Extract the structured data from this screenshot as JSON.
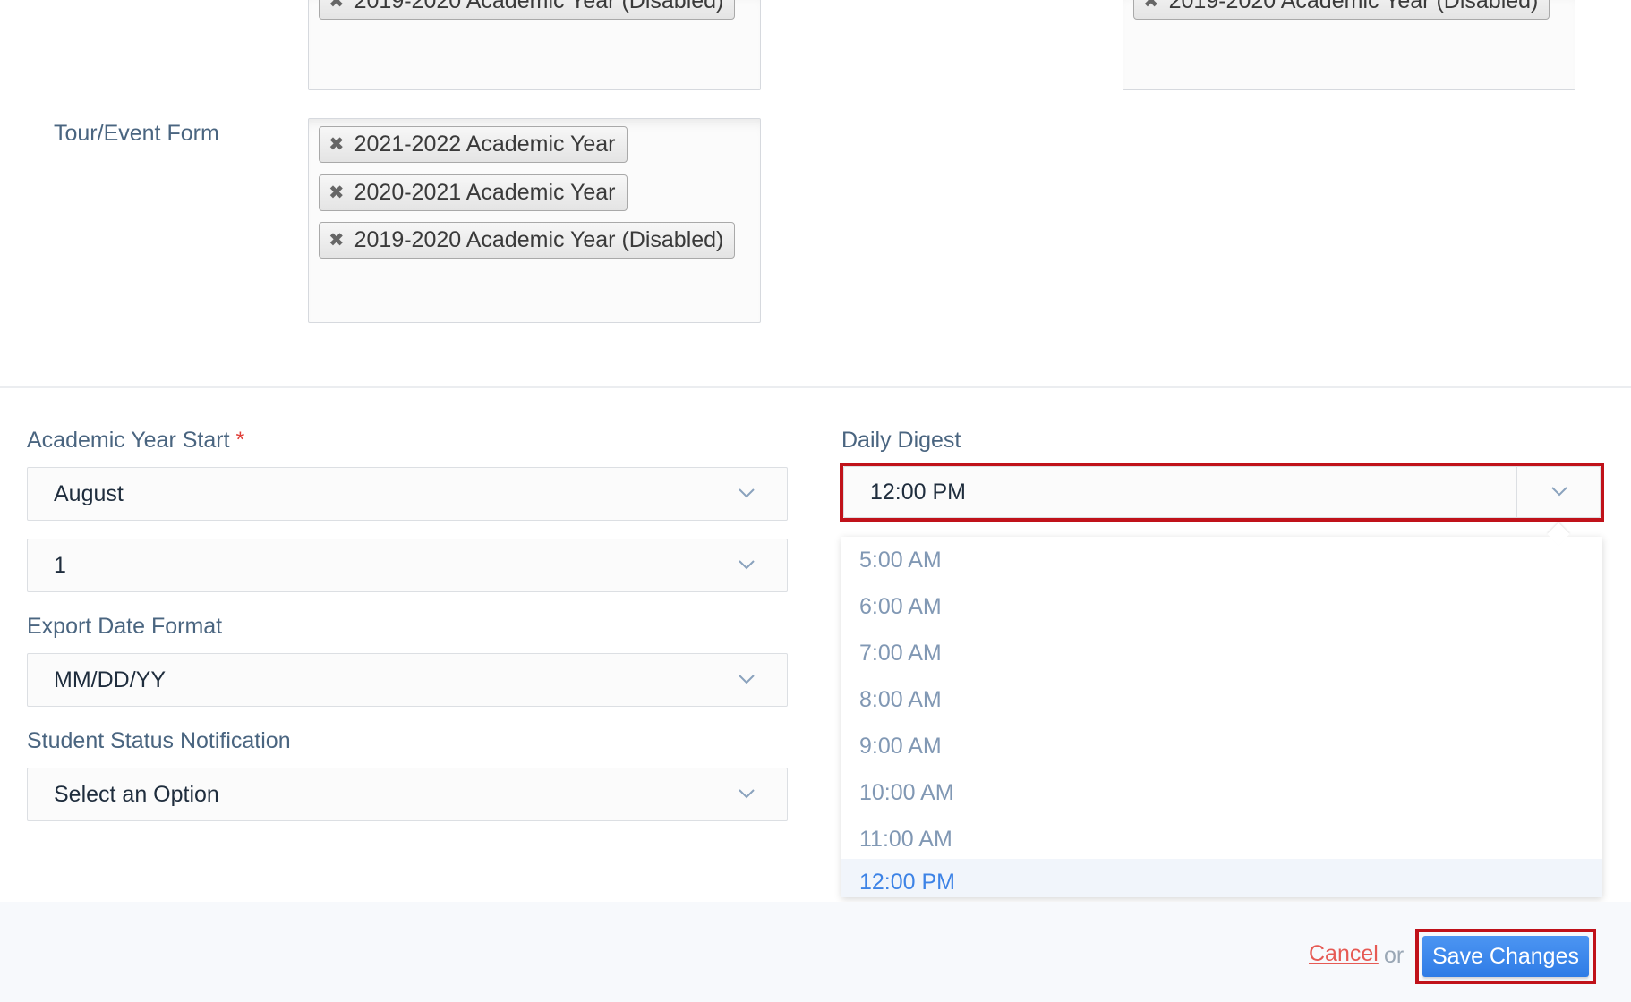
{
  "top_forms": {
    "left_box_chip": "2019-2020 Academic Year (Disabled)",
    "right_box_chip": "2019-2020 Academic Year (Disabled)"
  },
  "tour_event": {
    "label": "Tour/Event Form",
    "chips": [
      "2021-2022 Academic Year",
      "2020-2021 Academic Year",
      "2019-2020 Academic Year (Disabled)"
    ]
  },
  "settings": {
    "academic_year_start": {
      "label": "Academic Year Start",
      "required_mark": "*",
      "month": "August",
      "day": "1"
    },
    "export_date_format": {
      "label": "Export Date Format",
      "value": "MM/DD/YY"
    },
    "student_status_notification": {
      "label": "Student Status Notification",
      "value": "Select an Option"
    },
    "daily_digest": {
      "label": "Daily Digest",
      "value": "12:00 PM",
      "options": [
        "5:00 AM",
        "6:00 AM",
        "7:00 AM",
        "8:00 AM",
        "9:00 AM",
        "10:00 AM",
        "11:00 AM",
        "12:00 PM"
      ],
      "selected_index": 7
    }
  },
  "footer": {
    "cancel_label": "Cancel",
    "or_label": "or",
    "save_label": "Save Changes"
  },
  "colors": {
    "accent": "#2f7ce6",
    "highlight": "#c0121a",
    "label": "#4a6580",
    "option": "#8198b4"
  },
  "icons": {
    "remove": "close-icon",
    "caret": "chevron-down-icon"
  }
}
